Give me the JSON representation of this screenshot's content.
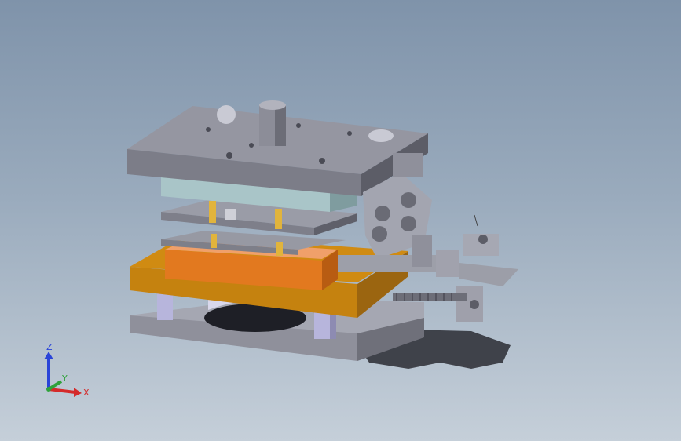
{
  "viewport": {
    "background_top": "#7f93aa",
    "background_bottom": "#c5cfd9"
  },
  "model": {
    "colors": {
      "steel": "#8e8f9a",
      "steel_light": "#a8aab4",
      "steel_dark": "#62636c",
      "glass": "#a9c4c8",
      "orange": "#e07a22",
      "gold": "#c8860f",
      "brass": "#e1b43c",
      "lavender": "#b9b7dc",
      "shadow": "#22232b"
    }
  },
  "triad": {
    "z_label": "Z",
    "y_label": "Y",
    "x_label": "X",
    "z_color": "#2a44d8",
    "y_color": "#2fa23a",
    "x_color": "#d42a2a"
  }
}
